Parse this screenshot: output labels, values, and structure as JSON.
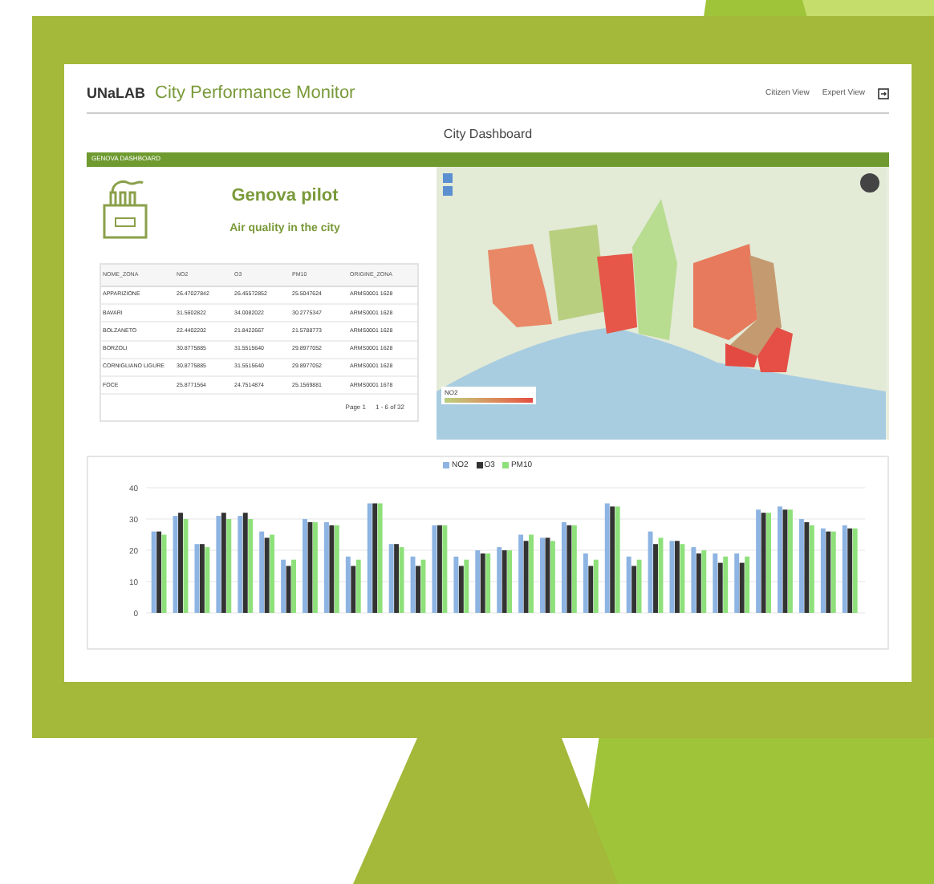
{
  "header": {
    "logo": "UNaLAB",
    "title": "City Performance Monitor",
    "links": [
      {
        "label": "Citizen View"
      },
      {
        "label": "Expert View"
      }
    ]
  },
  "page_title": "City Dashboard",
  "panel": {
    "title": "GENOVA DASHBOARD",
    "heading": "Genova pilot",
    "subheading": "Air quality in the city"
  },
  "table": {
    "columns": [
      "NOME_ZONA",
      "NO2",
      "O3",
      "PM10",
      "ORIGINE_ZONA"
    ],
    "rows": [
      [
        "APPARIZIONE",
        "26.47027842",
        "26.45572852",
        "25.5047624",
        "ARMS0001 1628"
      ],
      [
        "BAVARI",
        "31.5602822",
        "34.0082022",
        "30.2775347",
        "ARMS0001 1628"
      ],
      [
        "BOLZANETO",
        "22.4402202",
        "21.8422667",
        "21.5788773",
        "ARMS0001 1628"
      ],
      [
        "BORZOLI",
        "30.8775885",
        "31.5515640",
        "29.8977052",
        "ARMS0001 1628"
      ],
      [
        "CORNIGLIANO LIGURE",
        "30.8775885",
        "31.5515640",
        "29.8977052",
        "ARMS0001 1628"
      ],
      [
        "FOCE",
        "25.8771564",
        "24.7514874",
        "25.1569881",
        "ARMS0001 1678"
      ]
    ],
    "pager": {
      "page": "Page 1",
      "range": "1 - 6 of 32"
    }
  },
  "map": {
    "legend_title": "NO2"
  },
  "chart": {
    "chart_data": {
      "type": "bar",
      "grid": true,
      "yticks": [
        0,
        10,
        20,
        30,
        40
      ],
      "ylim": [
        0,
        40
      ],
      "series": [
        {
          "name": "NO2",
          "color": "#8db4e2",
          "values": [
            26,
            31,
            22,
            31,
            31,
            26,
            17,
            30,
            29,
            18,
            35,
            22,
            18,
            28,
            18,
            20,
            21,
            25,
            24,
            29,
            19,
            35,
            18,
            26,
            23,
            21,
            19,
            19,
            33,
            34,
            30,
            27,
            28
          ]
        },
        {
          "name": "O3",
          "color": "#333333",
          "values": [
            26,
            32,
            22,
            32,
            32,
            24,
            15,
            29,
            28,
            15,
            35,
            22,
            15,
            28,
            15,
            19,
            20,
            23,
            24,
            28,
            15,
            34,
            15,
            22,
            23,
            19,
            16,
            16,
            32,
            33,
            29,
            26,
            27
          ]
        },
        {
          "name": "PM10",
          "color": "#8ee07a",
          "values": [
            25,
            30,
            21,
            30,
            30,
            25,
            17,
            29,
            28,
            17,
            35,
            21,
            17,
            28,
            17,
            19,
            20,
            25,
            23,
            28,
            17,
            34,
            17,
            24,
            22,
            20,
            18,
            18,
            32,
            33,
            28,
            26,
            27
          ]
        }
      ]
    }
  }
}
